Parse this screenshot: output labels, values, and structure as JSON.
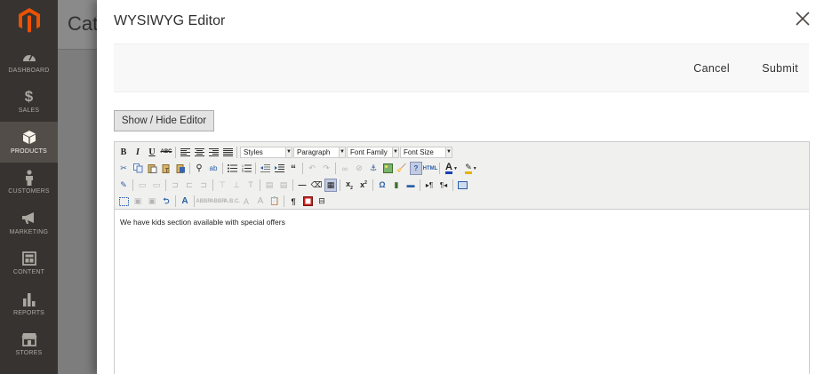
{
  "sidebar": {
    "logo_icon": "magento-logo-icon",
    "items": [
      {
        "label": "DASHBOARD",
        "icon": "speedometer-icon",
        "active": false
      },
      {
        "label": "SALES",
        "icon": "dollar-icon",
        "active": false
      },
      {
        "label": "PRODUCTS",
        "icon": "cube-icon",
        "active": true
      },
      {
        "label": "CUSTOMERS",
        "icon": "person-icon",
        "active": false
      },
      {
        "label": "MARKETING",
        "icon": "megaphone-icon",
        "active": false
      },
      {
        "label": "CONTENT",
        "icon": "layout-icon",
        "active": false
      },
      {
        "label": "REPORTS",
        "icon": "bar-chart-icon",
        "active": false
      },
      {
        "label": "STORES",
        "icon": "storefront-icon",
        "active": false
      }
    ]
  },
  "page": {
    "title": "Cat"
  },
  "modal": {
    "title": "WYSIWYG Editor",
    "cancel_label": "Cancel",
    "submit_label": "Submit",
    "toggle_label": "Show / Hide Editor"
  },
  "editor": {
    "selects": {
      "styles": "Styles",
      "paragraph": "Paragraph",
      "font_family": "Font Family",
      "font_size": "Font Size"
    },
    "content": "We have kids section available with special offers"
  },
  "colors": {
    "sidebar_bg": "#373330",
    "sidebar_active": "#524d49",
    "logo_orange": "#eb5202",
    "overlay": "#7d7d7d"
  }
}
